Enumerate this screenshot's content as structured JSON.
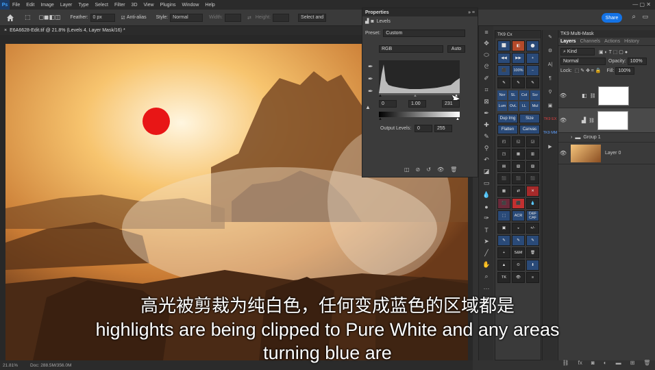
{
  "menubar": {
    "logo": "Ps",
    "items": [
      "File",
      "Edit",
      "Image",
      "Layer",
      "Type",
      "Select",
      "Filter",
      "3D",
      "View",
      "Plugins",
      "Window",
      "Help"
    ]
  },
  "options": {
    "feather_label": "Feather:",
    "feather_value": "0 px",
    "antialias_label": "Anti-alias",
    "style_label": "Style:",
    "style_value": "Normal",
    "width_label": "Width:",
    "height_label": "Height:",
    "select_btn": "Select and",
    "share_btn": "Share"
  },
  "document": {
    "tab_title": "E6A6628-Edit.tif @ 21.8% (Levels 4, Layer Mask/16) *",
    "zoom": "21.81%",
    "doc_size": "Doc: 288.5M/356.0M"
  },
  "properties": {
    "title": "Properties",
    "adjustment": "Levels",
    "preset_label": "Preset:",
    "preset_value": "Custom",
    "channel": "RGB",
    "auto_btn": "Auto",
    "input_black": "0",
    "input_gamma": "1.00",
    "input_white": "231",
    "output_label": "Output Levels:",
    "output_black": "0",
    "output_white": "255"
  },
  "tk9cx": {
    "title": "TK9 Cx",
    "rows": [
      [
        "⬜",
        "◧",
        "⬤"
      ],
      [
        "◀◀",
        "▶▶",
        "+"
      ],
      [
        "⬛",
        "100%",
        "−"
      ],
      [
        "✎",
        "✎",
        "✎"
      ],
      [
        "Nor",
        "SL",
        "Col",
        "Scr"
      ],
      [
        "Lum",
        "OvL",
        "LL",
        "Mul"
      ],
      [
        "Dup Img",
        "Size"
      ],
      [
        "Flatten",
        "Canvas"
      ],
      [
        "◰",
        "◱",
        "◲"
      ],
      [
        "◳",
        "▦",
        "▥"
      ],
      [
        "▤",
        "▧",
        "▨"
      ],
      [
        "⬛",
        "⬛",
        "⬛"
      ],
      [
        "▦",
        "⇄",
        "✕"
      ],
      [
        "⬛",
        "⬛",
        "💧"
      ],
      [
        "⬚",
        "ACR",
        "D&F CAF"
      ],
      [
        "▣",
        "◒",
        "+/-"
      ],
      [
        "✎",
        "✎",
        "✎"
      ],
      [
        "+",
        "S&M",
        "🗑"
      ],
      [
        "▲",
        "©",
        "⬇"
      ],
      [
        "TK",
        "👁",
        "≡"
      ]
    ]
  },
  "sidestrip": [
    "TK9 EX",
    "TK9 MM"
  ],
  "tk9mm": {
    "title": "TK9 Multi-Mask",
    "tabs": [
      "Layers",
      "Channels",
      "Actions",
      "History"
    ],
    "kind_label": "Kind",
    "blend_mode": "Normal",
    "opacity_label": "Opacity:",
    "opacity_value": "100%",
    "lock_label": "Lock:",
    "fill_label": "Fill:",
    "fill_value": "100%",
    "layers": [
      {
        "name": ""
      },
      {
        "name": ""
      },
      {
        "name": "Group 1"
      },
      {
        "name": "Layer 0"
      }
    ]
  },
  "subtitles": {
    "cn": "高光被剪裁为纯白色，任何变成蓝色的区域都是",
    "en1": "highlights are being clipped to Pure White and any areas",
    "en2": "turning blue are"
  }
}
